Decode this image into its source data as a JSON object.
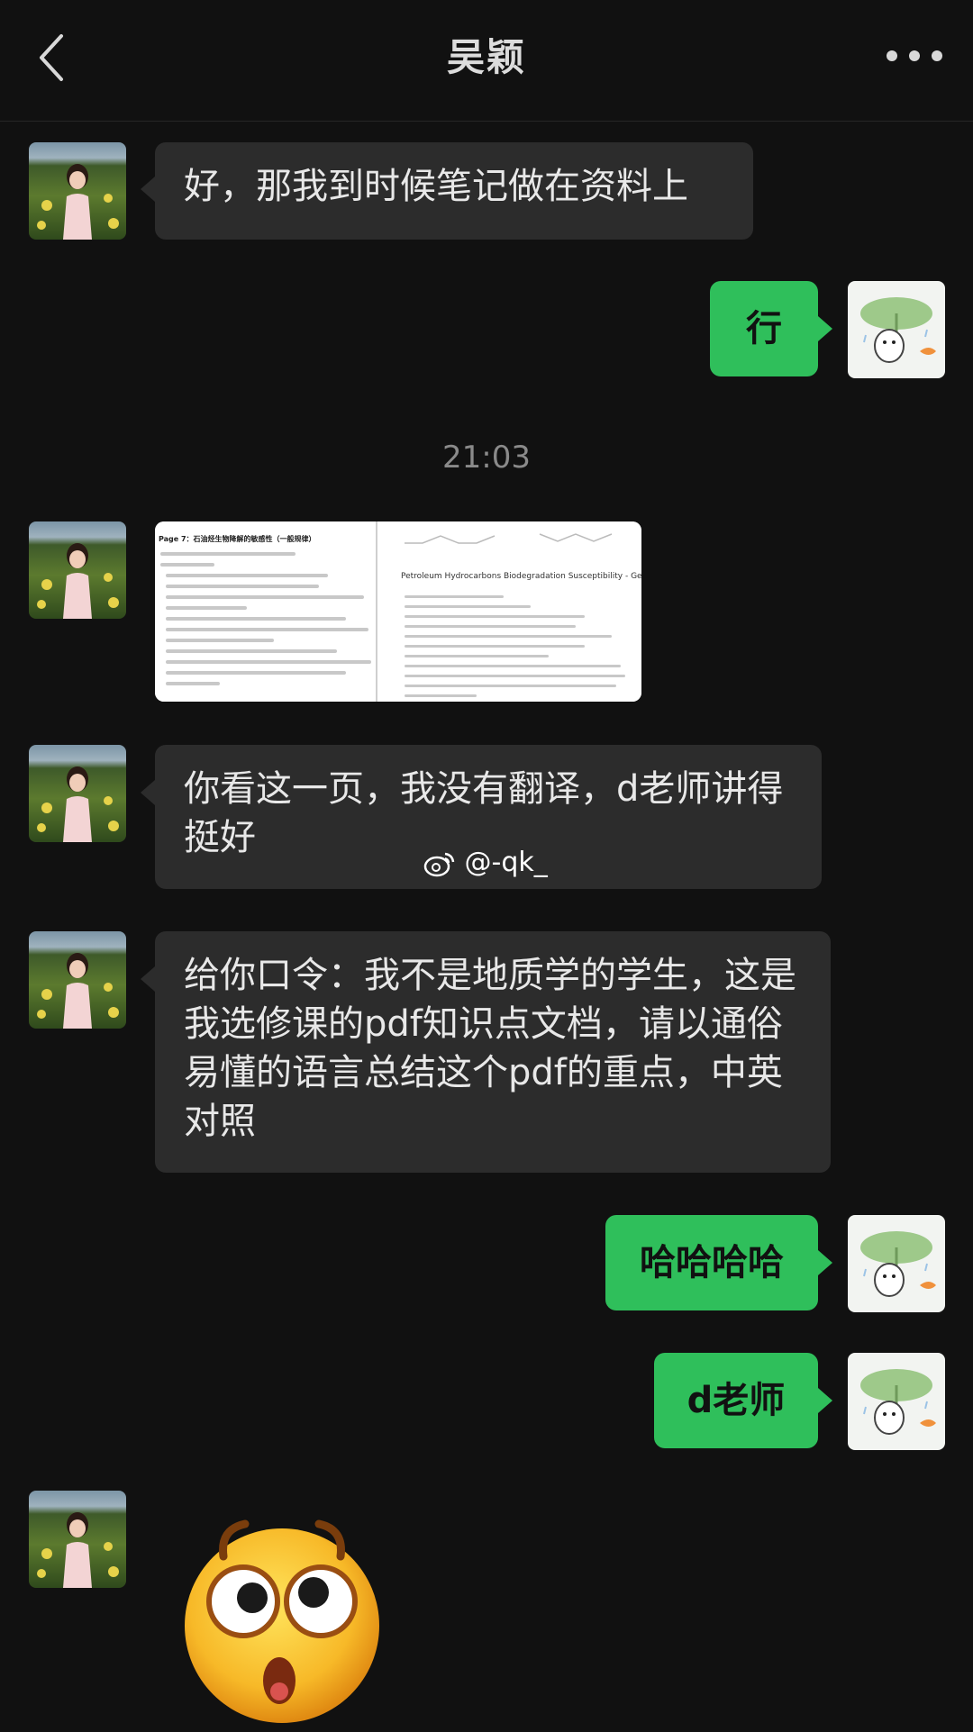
{
  "header": {
    "title": "吴颖",
    "back_icon": "chevron-left-icon",
    "more_icon": "more-dots-icon"
  },
  "messages": {
    "m1": {
      "sender": "other",
      "text": "好，那我到时候笔记做在资料上"
    },
    "m2": {
      "sender": "self",
      "text": "行"
    },
    "time_divider": "21:03",
    "m3": {
      "sender": "other",
      "type": "image",
      "left_title": "Page 7：石油烃生物降解的敏感性（一般规律）",
      "right_title": "Petroleum Hydrocarbons Biodegradation Susceptibility - General"
    },
    "m4": {
      "sender": "other",
      "text": "你看这一页，我没有翻译，d老师讲得挺好"
    },
    "m5": {
      "sender": "other",
      "text": "给你口令：我不是地质学的学生，这是我选修课的pdf知识点文档，请以通俗易懂的语言总结这个pdf的重点，中英对照"
    },
    "m6": {
      "sender": "self",
      "text": "哈哈哈哈"
    },
    "m7": {
      "sender": "self",
      "text": "d老师"
    },
    "m8": {
      "sender": "other",
      "type": "sticker",
      "sticker": "surprised-face-emoji"
    }
  },
  "watermark": {
    "text": "@-qk_",
    "icon": "weibo-icon"
  },
  "colors": {
    "background": "#111111",
    "bubble_other": "#2c2c2c",
    "bubble_self": "#2fbf5b",
    "timestamp": "#8a8a8a"
  }
}
